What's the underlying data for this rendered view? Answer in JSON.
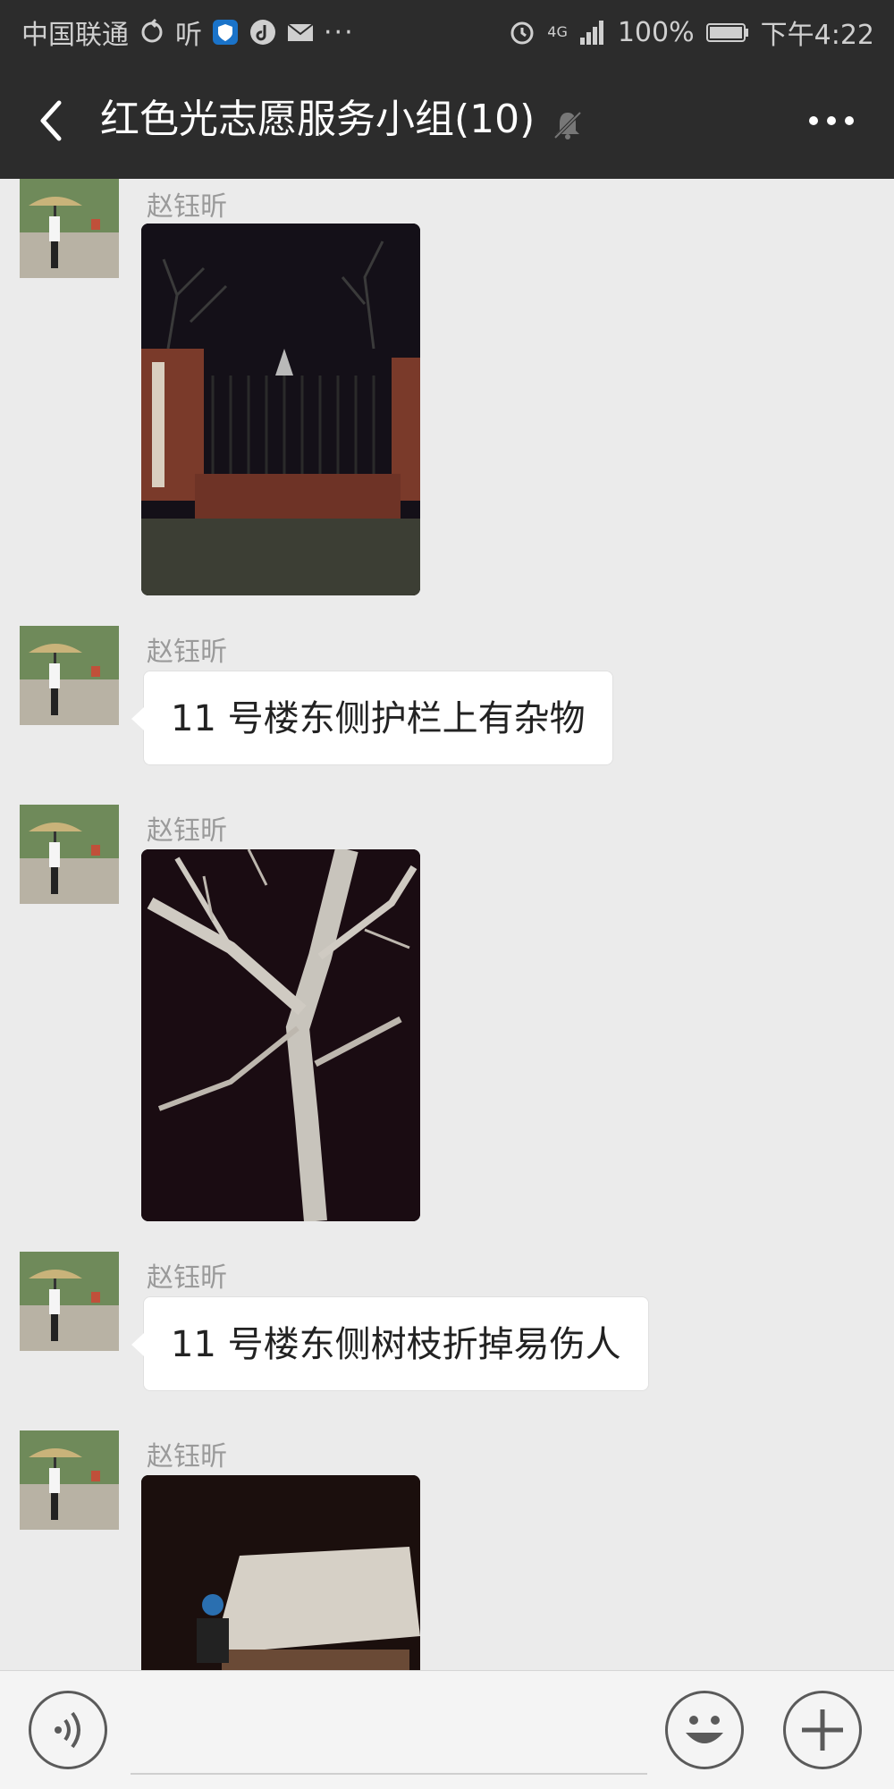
{
  "status_bar": {
    "carrier": "中国联通",
    "listen_label": "听",
    "network": "4G",
    "battery": "100%",
    "time": "下午4:22",
    "overflow": "···"
  },
  "header": {
    "title": "红色光志愿服务小组(10)",
    "icons": [
      "back-icon",
      "mute-bell-icon",
      "more-icon"
    ]
  },
  "messages": [
    {
      "type": "image",
      "sender": "赵钰昕",
      "image": "night-gate-photo"
    },
    {
      "type": "text",
      "sender": "赵钰昕",
      "text": "11 号楼东侧护栏上有杂物"
    },
    {
      "type": "image",
      "sender": "赵钰昕",
      "image": "night-tree-photo"
    },
    {
      "type": "text",
      "sender": "赵钰昕",
      "text": "11 号楼东侧树枝折掉易伤人"
    },
    {
      "type": "image",
      "sender": "赵钰昕",
      "image": "night-box-photo"
    }
  ],
  "input_bar": {
    "value": "",
    "icons": [
      "voice-icon",
      "emoji-icon",
      "plus-icon"
    ]
  },
  "colors": {
    "header_bg": "#2c2c2c",
    "chat_bg": "#ebebeb",
    "bubble_bg": "#ffffff",
    "sender_text": "#9a9a9a"
  }
}
